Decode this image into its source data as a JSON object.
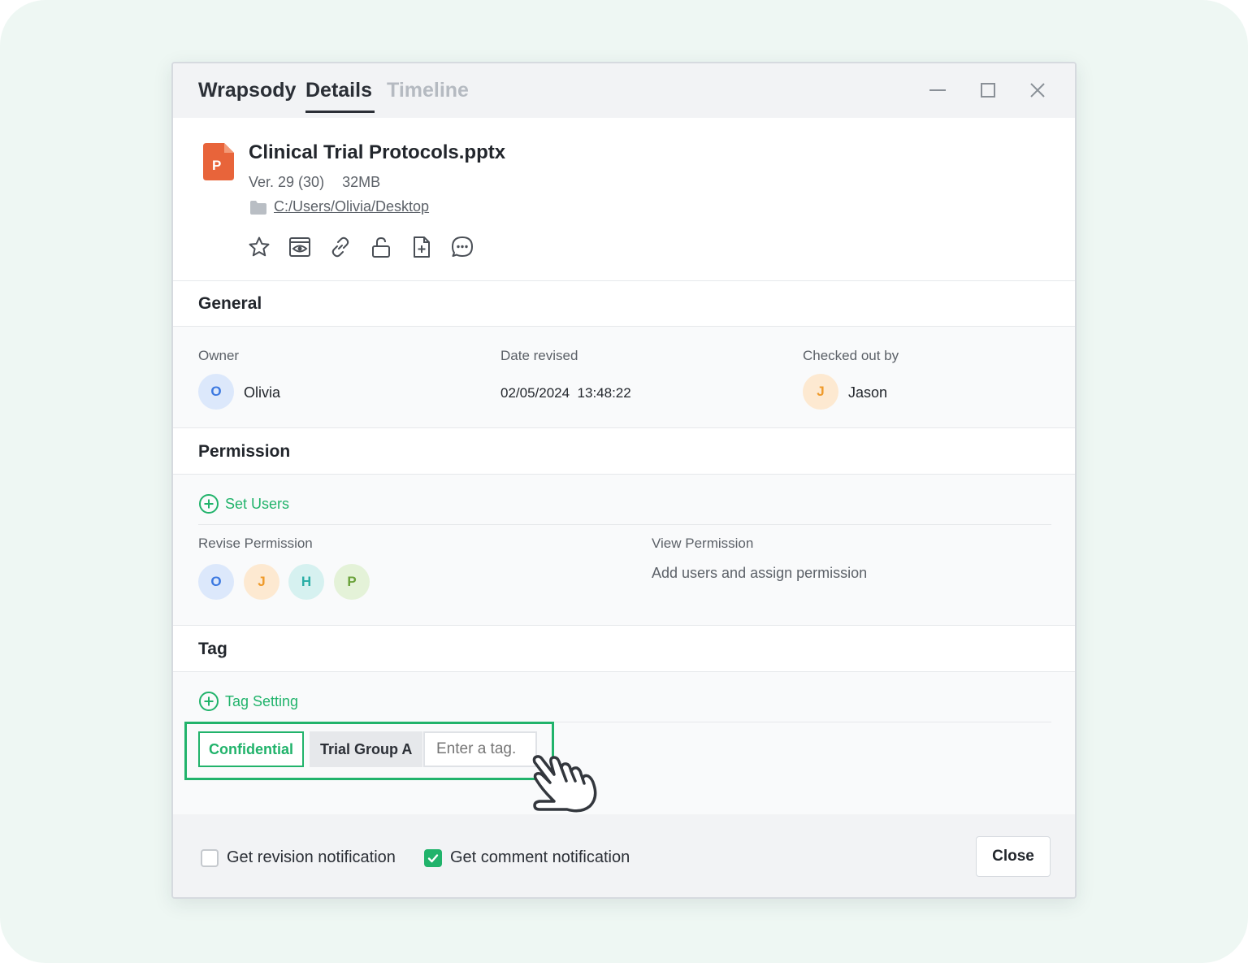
{
  "tabs": {
    "app": "Wrapsody",
    "details": "Details",
    "timeline": "Timeline"
  },
  "file": {
    "icon_letter": "P",
    "name": "Clinical Trial Protocols.pptx",
    "version": "Ver. 29 (30)",
    "size": "32MB",
    "path": "C:/Users/Olivia/Desktop"
  },
  "general": {
    "title": "General",
    "owner_label": "Owner",
    "owner_initial": "O",
    "owner_name": "Olivia",
    "date_label": "Date revised",
    "date_value": "02/05/2024  13:48:22",
    "checked_label": "Checked out by",
    "checked_initial": "J",
    "checked_name": "Jason"
  },
  "permission": {
    "title": "Permission",
    "set_users": "Set Users",
    "revise_label": "Revise Permission",
    "revise_avatars": [
      "O",
      "J",
      "H",
      "P"
    ],
    "view_label": "View Permission",
    "view_value": "Add users and assign permission"
  },
  "tag": {
    "title": "Tag",
    "setting": "Tag Setting",
    "tags": [
      "Confidential",
      "Trial Group A"
    ],
    "input_placeholder": "Enter a tag."
  },
  "footer": {
    "revision_notification": "Get revision notification",
    "revision_checked": false,
    "comment_notification": "Get comment notification",
    "comment_checked": true,
    "close": "Close"
  },
  "colors": {
    "accent": "#21b36b",
    "file_icon": "#e8643a"
  }
}
